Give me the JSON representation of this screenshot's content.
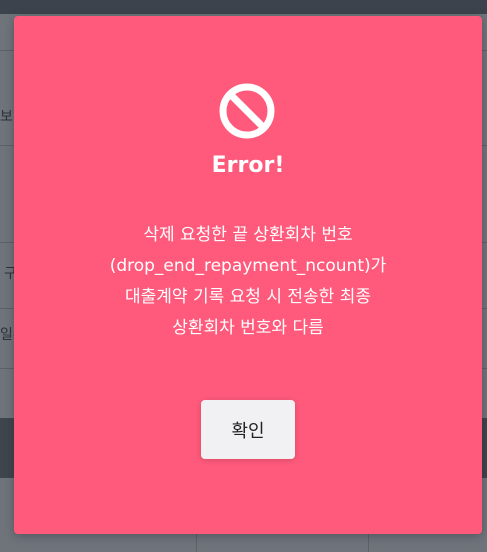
{
  "background": {
    "row_labels": [
      "보",
      "구",
      "일주"
    ]
  },
  "dialog": {
    "icon": "ban-icon",
    "title": "Error!",
    "message_lines": [
      "삭제 요청한 끝 상환회차 번호",
      "(drop_end_repayment_ncount)가",
      "대출계약 기록 요청 시 전송한 최종",
      "상환회차 번호와 다름"
    ],
    "confirm_label": "확인"
  },
  "colors": {
    "dialog_bg": "#ff5a7c",
    "icon_color": "#ffffff",
    "button_bg": "#f1f1f4"
  }
}
